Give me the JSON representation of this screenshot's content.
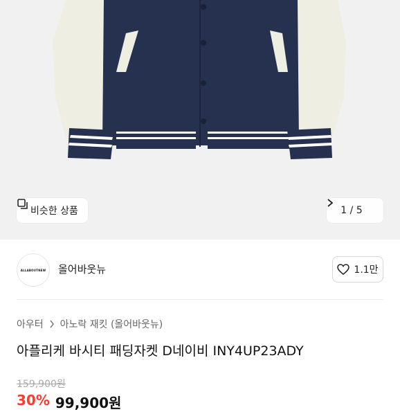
{
  "gallery": {
    "similar_label": "비슷한 상품",
    "current": "1",
    "separator": "/",
    "total": "5"
  },
  "seller": {
    "avatar_text": "ALLABOUTNEW",
    "name": "올어바웃뉴",
    "likes": "1.1만"
  },
  "breadcrumb": {
    "items": [
      "아우터",
      "아노락 재킷 (올어바웃뉴)"
    ]
  },
  "product": {
    "title": "아플리케 바시티 패딩자켓 D네이비 INY4UP23ADY",
    "original_price": "159,900원",
    "discount": "30%",
    "sale_price": "99,900원"
  },
  "icons": [
    "copy-icon",
    "chevron-right-icon",
    "heart-icon",
    "breadcrumb-chevron-icon"
  ],
  "colors": {
    "navy": "#26304f",
    "cream": "#eeeee2",
    "discount_red": "#ff3b2f"
  }
}
